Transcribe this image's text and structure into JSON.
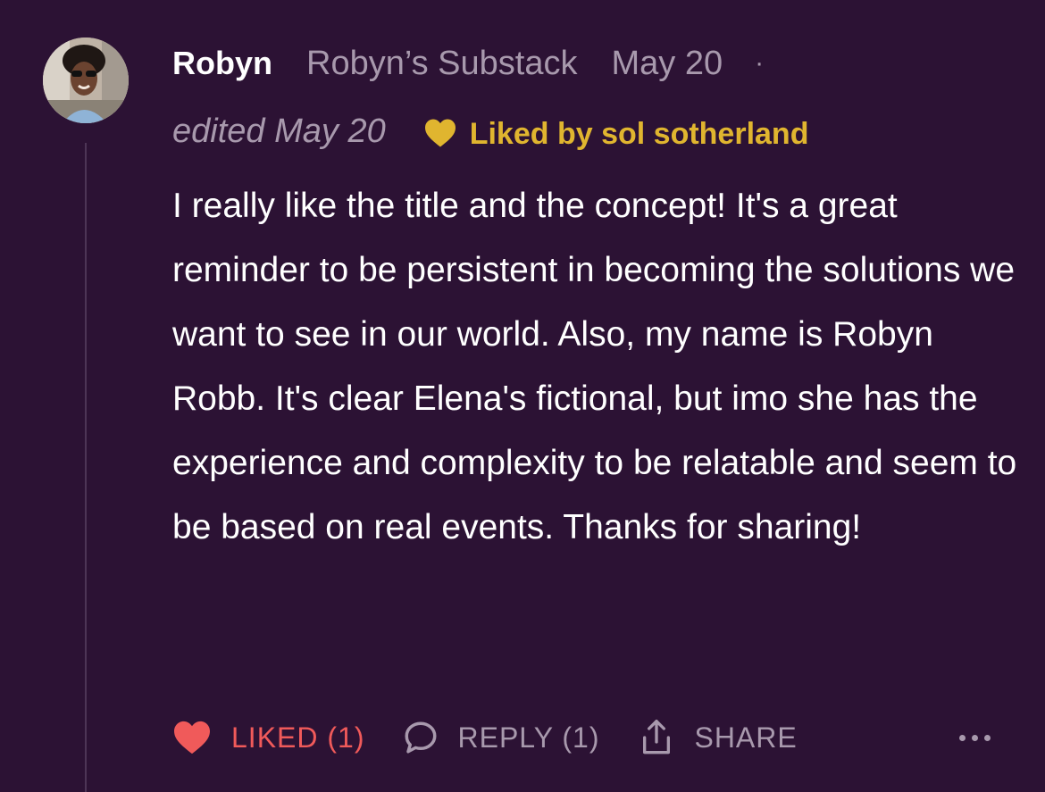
{
  "comment": {
    "author": "Robyn",
    "publication": "Robyn’s Substack",
    "date": "May 20",
    "separator": "·",
    "edited": "edited May 20",
    "liked_by": "Liked by sol sotherland",
    "body": "I really like the title and the concept! It's a great reminder to be persistent in becoming the solutions we want to see in our world. Also, my name is Robyn Robb. It's clear Elena's fictional, but imo she has the experience and complexity to be relatable and seem to be based on real events. Thanks for sharing!"
  },
  "actions": {
    "like_label": "LIKED (1)",
    "reply_label": "REPLY (1)",
    "share_label": "SHARE"
  },
  "icons": {
    "liked_by": "heart-icon",
    "like": "heart-filled-icon",
    "reply": "speech-bubble-icon",
    "share": "share-upload-icon",
    "more": "more-dots-icon"
  },
  "colors": {
    "background": "#2c1234",
    "liked_by_gold": "#e0b52f",
    "liked_red": "#f05a5a",
    "muted_text": "#a899ad"
  }
}
